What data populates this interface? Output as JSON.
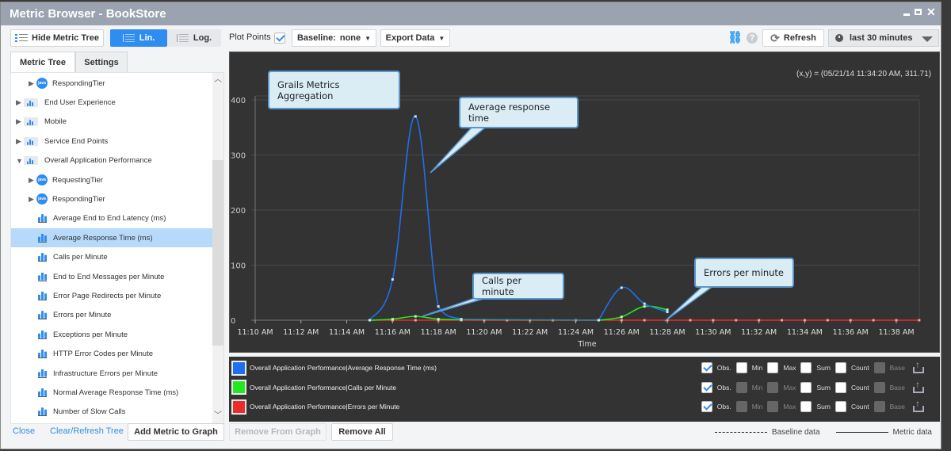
{
  "window": {
    "title": "Metric Browser - BookStore",
    "controls": [
      "minimize",
      "maximize",
      "close"
    ]
  },
  "toolbar": {
    "hide_tree_label": "Hide Metric Tree",
    "lin_label": "Lin.",
    "log_label": "Log.",
    "scale_selected": "Lin.",
    "plot_points_label": "Plot Points",
    "plot_points_checked": true,
    "baseline_label": "Baseline:",
    "baseline_value": "none",
    "export_label": "Export Data",
    "refresh_label": "Refresh",
    "time_range": "last 30 minutes",
    "accent_color": "#2f8cf1"
  },
  "left_panel": {
    "tabs": [
      {
        "label": "Metric Tree",
        "active": true
      },
      {
        "label": "Settings",
        "active": false
      }
    ],
    "tree": [
      {
        "label": "RespondingTier",
        "icon": "java-icon",
        "level": 1,
        "expander": "collapsed"
      },
      {
        "label": "End User Experience",
        "icon": "folder-chart-icon",
        "level": 0,
        "expander": "collapsed"
      },
      {
        "label": "Mobile",
        "icon": "folder-chart-icon",
        "level": 0,
        "expander": "collapsed"
      },
      {
        "label": "Service End Points",
        "icon": "folder-chart-icon",
        "level": 0,
        "expander": "collapsed"
      },
      {
        "label": "Overall Application Performance",
        "icon": "folder-chart-icon",
        "level": 0,
        "expander": "expanded"
      },
      {
        "label": "RequestingTier",
        "icon": "java-icon",
        "level": 1,
        "expander": "collapsed"
      },
      {
        "label": "RespondingTier",
        "icon": "java-icon",
        "level": 1,
        "expander": "collapsed"
      },
      {
        "label": "Average End to End Latency (ms)",
        "icon": "metric-icon",
        "level": 1,
        "expander": "none"
      },
      {
        "label": "Average Response Time (ms)",
        "icon": "metric-icon",
        "level": 1,
        "expander": "none",
        "selected": true
      },
      {
        "label": "Calls per Minute",
        "icon": "metric-icon",
        "level": 1,
        "expander": "none"
      },
      {
        "label": "End to End Messages per Minute",
        "icon": "metric-icon",
        "level": 1,
        "expander": "none"
      },
      {
        "label": "Error Page Redirects per Minute",
        "icon": "metric-icon",
        "level": 1,
        "expander": "none"
      },
      {
        "label": "Errors per Minute",
        "icon": "metric-icon",
        "level": 1,
        "expander": "none"
      },
      {
        "label": "Exceptions per Minute",
        "icon": "metric-icon",
        "level": 1,
        "expander": "none"
      },
      {
        "label": "HTTP Error Codes per Minute",
        "icon": "metric-icon",
        "level": 1,
        "expander": "none"
      },
      {
        "label": "Infrastructure Errors per Minute",
        "icon": "metric-icon",
        "level": 1,
        "expander": "none"
      },
      {
        "label": "Normal Average Response Time (ms)",
        "icon": "metric-icon",
        "level": 1,
        "expander": "none"
      },
      {
        "label": "Number of Slow Calls",
        "icon": "metric-icon",
        "level": 1,
        "expander": "none"
      }
    ],
    "close_label": "Close",
    "clear_refresh_label": "Clear/Refresh Tree",
    "add_metric_label": "Add Metric to Graph"
  },
  "chart_panel": {
    "coord_readout": "(x,y) = (05/21/14 11:34:20 AM, 311.71)",
    "callouts": [
      {
        "id": "title",
        "text": "Grails Metrics Aggregation"
      },
      {
        "id": "avg",
        "text": "Average response time"
      },
      {
        "id": "calls",
        "text": "Calls per minute"
      },
      {
        "id": "errors",
        "text": "Errors per minute"
      }
    ],
    "remove_from_graph_label": "Remove From Graph",
    "remove_all_label": "Remove All",
    "baseline_key_label": "Baseline data",
    "metric_key_label": "Metric data"
  },
  "legend": [
    {
      "label": "Overall Application Performance|Average Response Time (ms)",
      "color": "#1f6ff0",
      "options": {
        "Obs.": {
          "checked": true,
          "enabled": true
        },
        "Min": {
          "checked": false,
          "enabled": true
        },
        "Max": {
          "checked": false,
          "enabled": true
        },
        "Sum": {
          "checked": false,
          "enabled": true
        },
        "Count": {
          "checked": false,
          "enabled": true
        },
        "Base": {
          "checked": false,
          "enabled": false
        }
      }
    },
    {
      "label": "Overall Application Performance|Calls per Minute",
      "color": "#22e822",
      "options": {
        "Obs.": {
          "checked": true,
          "enabled": true
        },
        "Min": {
          "checked": false,
          "enabled": false
        },
        "Max": {
          "checked": false,
          "enabled": false
        },
        "Sum": {
          "checked": false,
          "enabled": true
        },
        "Count": {
          "checked": false,
          "enabled": true
        },
        "Base": {
          "checked": false,
          "enabled": false
        }
      }
    },
    {
      "label": "Overall Application Performance|Errors per Minute",
      "color": "#ee2b2b",
      "options": {
        "Obs.": {
          "checked": true,
          "enabled": true
        },
        "Min": {
          "checked": false,
          "enabled": false
        },
        "Max": {
          "checked": false,
          "enabled": false
        },
        "Sum": {
          "checked": false,
          "enabled": true
        },
        "Count": {
          "checked": false,
          "enabled": true
        },
        "Base": {
          "checked": false,
          "enabled": false
        }
      }
    }
  ],
  "legend_option_labels": [
    "Obs.",
    "Min",
    "Max",
    "Sum",
    "Count",
    "Base"
  ],
  "chart_data": {
    "type": "line",
    "title": "",
    "xlabel": "Time",
    "ylabel": "",
    "x_tick_labels": [
      "11:10 AM",
      "11:12 AM",
      "11:14 AM",
      "11:16 AM",
      "11:18 AM",
      "11:20 AM",
      "11:22 AM",
      "11:24 AM",
      "11:26 AM",
      "11:28 AM",
      "11:30 AM",
      "11:32 AM",
      "11:34 AM",
      "11:36 AM",
      "11:38 AM"
    ],
    "x_range_minutes": [
      0,
      29
    ],
    "x_origin": "11:10 AM",
    "y_ticks": [
      0,
      100,
      200,
      300,
      400
    ],
    "ylim": [
      0,
      400
    ],
    "grid": true,
    "plot_points": true,
    "series": [
      {
        "name": "Overall Application Performance|Average Response Time (ms)",
        "color": "#1f6ff0",
        "x_minutes": [
          5,
          6,
          7,
          8,
          9,
          15,
          16,
          17,
          18
        ],
        "values": [
          0,
          74,
          370,
          25,
          2,
          0,
          59,
          30,
          15
        ]
      },
      {
        "name": "Overall Application Performance|Calls per Minute",
        "color": "#22e822",
        "x_minutes": [
          5,
          6,
          7,
          8,
          9,
          15,
          16,
          17,
          18
        ],
        "values": [
          0,
          2,
          7,
          2,
          1,
          0,
          6,
          25,
          19
        ]
      },
      {
        "name": "Overall Application Performance|Errors per Minute",
        "color": "#ee2b2b",
        "x_minutes": [
          5,
          6,
          7,
          8,
          9,
          10,
          11,
          12,
          13,
          14,
          15,
          16,
          17,
          18,
          19,
          20,
          21,
          22,
          23,
          24,
          25,
          26,
          27,
          28,
          29
        ],
        "values": [
          0,
          0,
          0,
          0,
          0,
          0,
          0,
          0,
          0,
          0,
          0,
          0,
          0,
          0,
          0,
          0,
          0,
          0,
          0,
          0,
          0,
          0,
          0,
          0,
          0
        ]
      }
    ]
  }
}
